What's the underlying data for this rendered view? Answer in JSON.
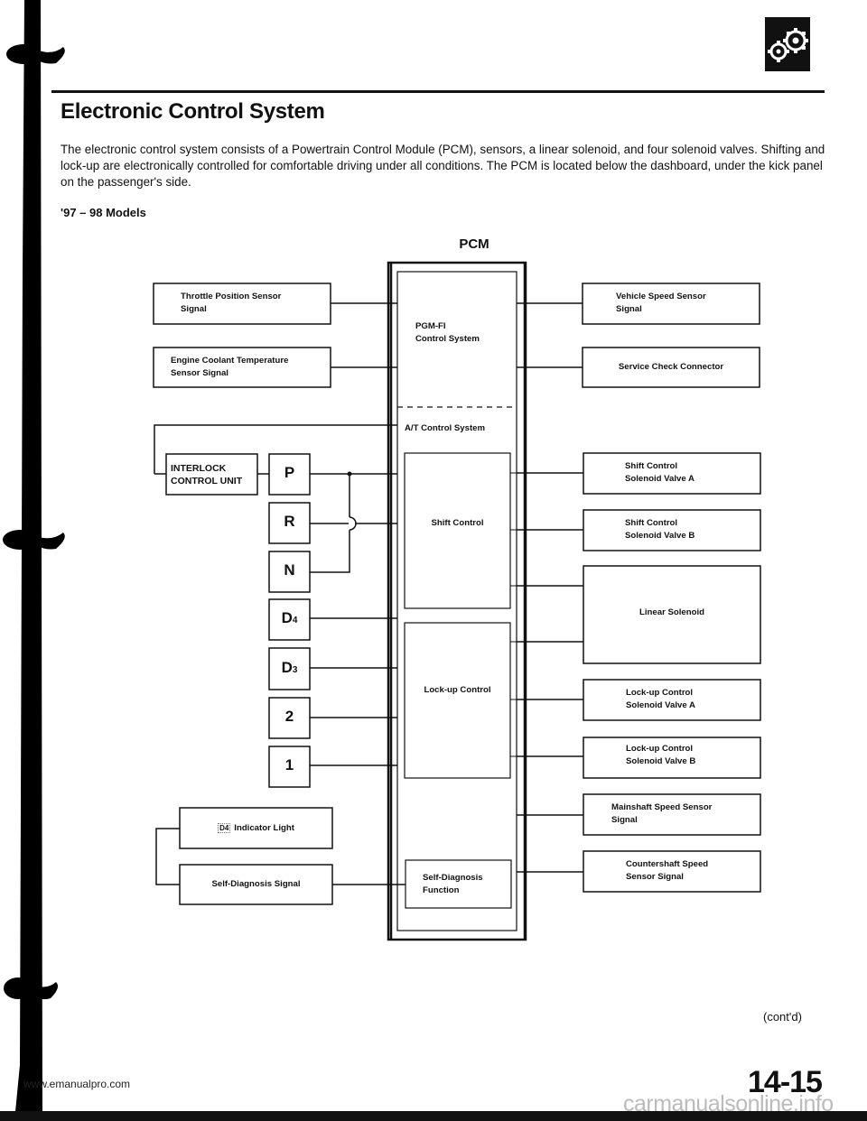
{
  "page": {
    "title": "Electronic Control System",
    "intro": "The electronic control system consists of a Powertrain Control Module (PCM), sensors, a linear solenoid, and four solenoid valves. Shifting and lock-up are electronically controlled for comfortable driving under all conditions. The PCM is located below the dashboard, under the kick panel on the passenger's side.",
    "subhead": "'97 – 98 Models",
    "section_icon": "gears-icon",
    "continued": "(cont'd)",
    "page_number": "14-15",
    "footer_url": "www.emanualpro.com",
    "footer_site": "carmanualsonline.info"
  },
  "diagram": {
    "pcm_label": "PCM",
    "pcm_sections": {
      "pgm_fi": [
        "PGM-FI",
        "Control System"
      ],
      "at_control": "A/T Control System",
      "shift_control": "Shift Control",
      "lockup_control": "Lock-up Control",
      "self_diagnosis": [
        "Self-Diagnosis",
        "Function"
      ]
    },
    "inputs_left": {
      "throttle": [
        "Throttle Position Sensor",
        "Signal"
      ],
      "coolant": [
        "Engine Coolant Temperature",
        "Sensor Signal"
      ],
      "interlock": [
        "INTERLOCK",
        "CONTROL UNIT"
      ],
      "d4_indicator": {
        "badge": "D4",
        "label": "Indicator Light"
      },
      "self_diag_signal": "Self-Diagnosis Signal"
    },
    "gear_positions": [
      {
        "main": "P",
        "sub": ""
      },
      {
        "main": "R",
        "sub": ""
      },
      {
        "main": "N",
        "sub": ""
      },
      {
        "main": "D",
        "sub": "4"
      },
      {
        "main": "D",
        "sub": "3"
      },
      {
        "main": "2",
        "sub": ""
      },
      {
        "main": "1",
        "sub": ""
      }
    ],
    "outputs_right": {
      "vss": [
        "Vehicle Speed Sensor",
        "Signal"
      ],
      "scc": [
        "Service Check Connector"
      ],
      "shift_a": [
        "Shift Control",
        "Solenoid Valve A"
      ],
      "shift_b": [
        "Shift Control",
        "Solenoid Valve B"
      ],
      "linear": [
        "Linear Solenoid"
      ],
      "lockup_a": [
        "Lock-up Control",
        "Solenoid Valve A"
      ],
      "lockup_b": [
        "Lock-up Control",
        "Solenoid Valve B"
      ],
      "mainshaft": [
        "Mainshaft Speed Sensor",
        "Signal"
      ],
      "countershaft": [
        "Countershaft Speed",
        "Sensor Signal"
      ]
    }
  }
}
